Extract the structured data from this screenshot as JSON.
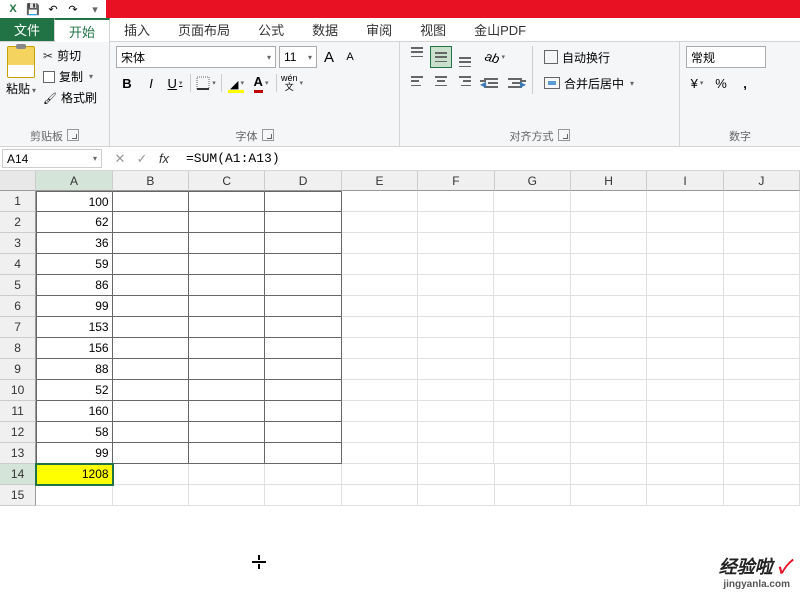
{
  "qat": {
    "save": "💾",
    "undo": "↶",
    "redo": "↷"
  },
  "tabs": {
    "file": "文件",
    "home": "开始",
    "insert": "插入",
    "layout": "页面布局",
    "formulas": "公式",
    "data": "数据",
    "review": "审阅",
    "view": "视图",
    "pdf": "金山PDF"
  },
  "clipboard": {
    "paste": "粘贴",
    "cut": "剪切",
    "copy": "复制",
    "painter": "格式刷",
    "group": "剪贴板"
  },
  "font": {
    "name": "宋体",
    "size": "11",
    "grow": "A",
    "shrink": "A",
    "bold": "B",
    "italic": "I",
    "underline": "U",
    "ruby": "wén",
    "ruby2": "文",
    "group": "字体"
  },
  "alignment": {
    "wrap": "自动换行",
    "merge": "合并后居中",
    "group": "对齐方式"
  },
  "number": {
    "format": "常规",
    "percent": "%",
    "comma": ",",
    "group": "数字"
  },
  "namebox": "A14",
  "formula": "=SUM(A1:A13)",
  "fx": "fx",
  "columns": [
    "A",
    "B",
    "C",
    "D",
    "E",
    "F",
    "G",
    "H",
    "I",
    "J"
  ],
  "rows": [
    "1",
    "2",
    "3",
    "4",
    "5",
    "6",
    "7",
    "8",
    "9",
    "10",
    "11",
    "12",
    "13",
    "14",
    "15"
  ],
  "cells": {
    "A1": "100",
    "A2": "62",
    "A3": "36",
    "A4": "59",
    "A5": "86",
    "A6": "99",
    "A7": "153",
    "A8": "156",
    "A9": "88",
    "A10": "52",
    "A11": "160",
    "A12": "58",
    "A13": "99",
    "A14": "1208"
  },
  "selected_cell": "A14",
  "bordered_range": {
    "cols": [
      "A",
      "B",
      "C",
      "D"
    ],
    "rows_from": 1,
    "rows_to": 13
  },
  "watermark": {
    "main": "经验啦",
    "check": "✓",
    "sub": "jingyanla.com"
  }
}
